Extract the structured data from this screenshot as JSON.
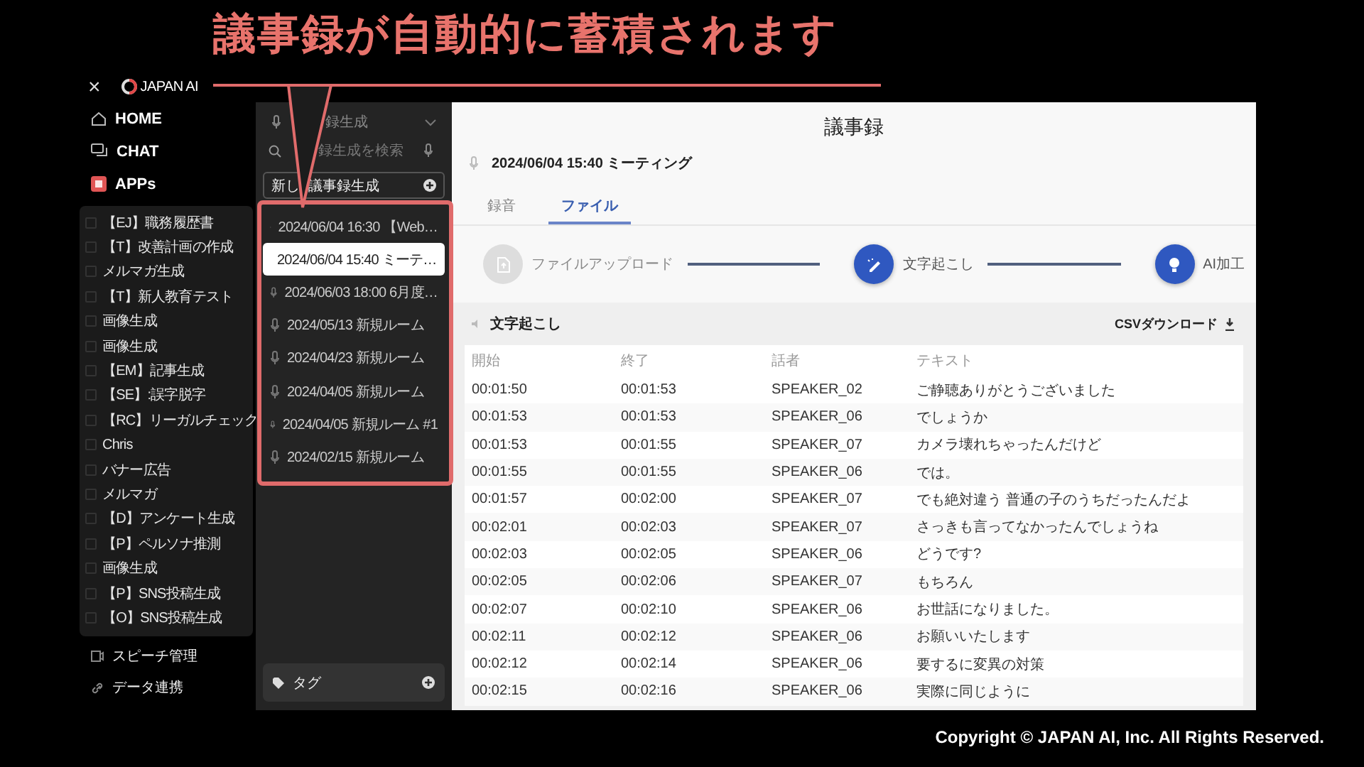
{
  "slide": {
    "heading": "議事録が自動的に蓄積されます",
    "copyright": "Copyright © JAPAN AI, Inc. All Rights Reserved."
  },
  "nav": {
    "close": "×",
    "logo": "JAPAN AI",
    "items": [
      "HOME",
      "CHAT",
      "APPs"
    ],
    "apps": [
      "【EJ】職務履歴書",
      "【T】改善計画の作成",
      "メルマガ生成",
      "【T】新人教育テスト",
      "画像生成",
      "画像生成",
      "【EM】記事生成",
      "【SE】:誤字脱字",
      "【RC】リーガルチェック",
      "Chris",
      "バナー広告",
      "メルマガ",
      "【D】アンケート生成",
      "【P】ペルソナ推測",
      "画像生成",
      "【P】SNS投稿生成",
      "【O】SNS投稿生成"
    ],
    "footer_items": [
      "スピーチ管理",
      "データ連携"
    ]
  },
  "records_panel": {
    "dropdown": "録生成",
    "search_placeholder": "録生成を検索",
    "new_button": [
      "新し",
      "議事録生成"
    ],
    "records": [
      {
        "label": "2024/06/04 16:30 【Web…",
        "selected": false
      },
      {
        "label": "2024/06/04 15:40 ミーテ…",
        "selected": true
      },
      {
        "label": "2024/06/03 18:00 6月度…",
        "selected": false
      },
      {
        "label": "2024/05/13 新規ルーム",
        "selected": false
      },
      {
        "label": "2024/04/23 新規ルーム",
        "selected": false
      },
      {
        "label": "2024/04/05 新規ルーム",
        "selected": false
      },
      {
        "label": "2024/04/05 新規ルーム #1",
        "selected": false
      },
      {
        "label": "2024/02/15 新規ルーム",
        "selected": false
      }
    ],
    "tag_button": "タグ"
  },
  "main": {
    "title": "議事録",
    "meeting": "2024/06/04 15:40 ミーティング",
    "tabs": [
      {
        "label": "録音",
        "selected": false
      },
      {
        "label": "ファイル",
        "selected": true
      }
    ],
    "steps": [
      {
        "label": "ファイルアップロード",
        "active": false
      },
      {
        "label": "文字起こし",
        "active": true
      },
      {
        "label": "AI加工",
        "active": true
      }
    ],
    "section_title": "文字起こし",
    "csv_button": "CSVダウンロード",
    "table": {
      "columns": [
        "開始",
        "終了",
        "話者",
        "テキスト"
      ],
      "rows": [
        [
          "00:01:50",
          "00:01:53",
          "SPEAKER_02",
          "ご静聴ありがとうございました"
        ],
        [
          "00:01:53",
          "00:01:53",
          "SPEAKER_06",
          "でしょうか"
        ],
        [
          "00:01:53",
          "00:01:55",
          "SPEAKER_07",
          "カメラ壊れちゃったんだけど"
        ],
        [
          "00:01:55",
          "00:01:55",
          "SPEAKER_06",
          "では。"
        ],
        [
          "00:01:57",
          "00:02:00",
          "SPEAKER_07",
          "でも絶対違う 普通の子のうちだったんだよ"
        ],
        [
          "00:02:01",
          "00:02:03",
          "SPEAKER_07",
          "さっきも言ってなかったんでしょうね"
        ],
        [
          "00:02:03",
          "00:02:05",
          "SPEAKER_06",
          "どうです?"
        ],
        [
          "00:02:05",
          "00:02:06",
          "SPEAKER_07",
          "もちろん"
        ],
        [
          "00:02:07",
          "00:02:10",
          "SPEAKER_06",
          "お世話になりました。"
        ],
        [
          "00:02:11",
          "00:02:12",
          "SPEAKER_06",
          "お願いいたします"
        ],
        [
          "00:02:12",
          "00:02:14",
          "SPEAKER_06",
          "要するに変異の対策"
        ],
        [
          "00:02:15",
          "00:02:16",
          "SPEAKER_06",
          "実際に同じように"
        ]
      ]
    }
  }
}
